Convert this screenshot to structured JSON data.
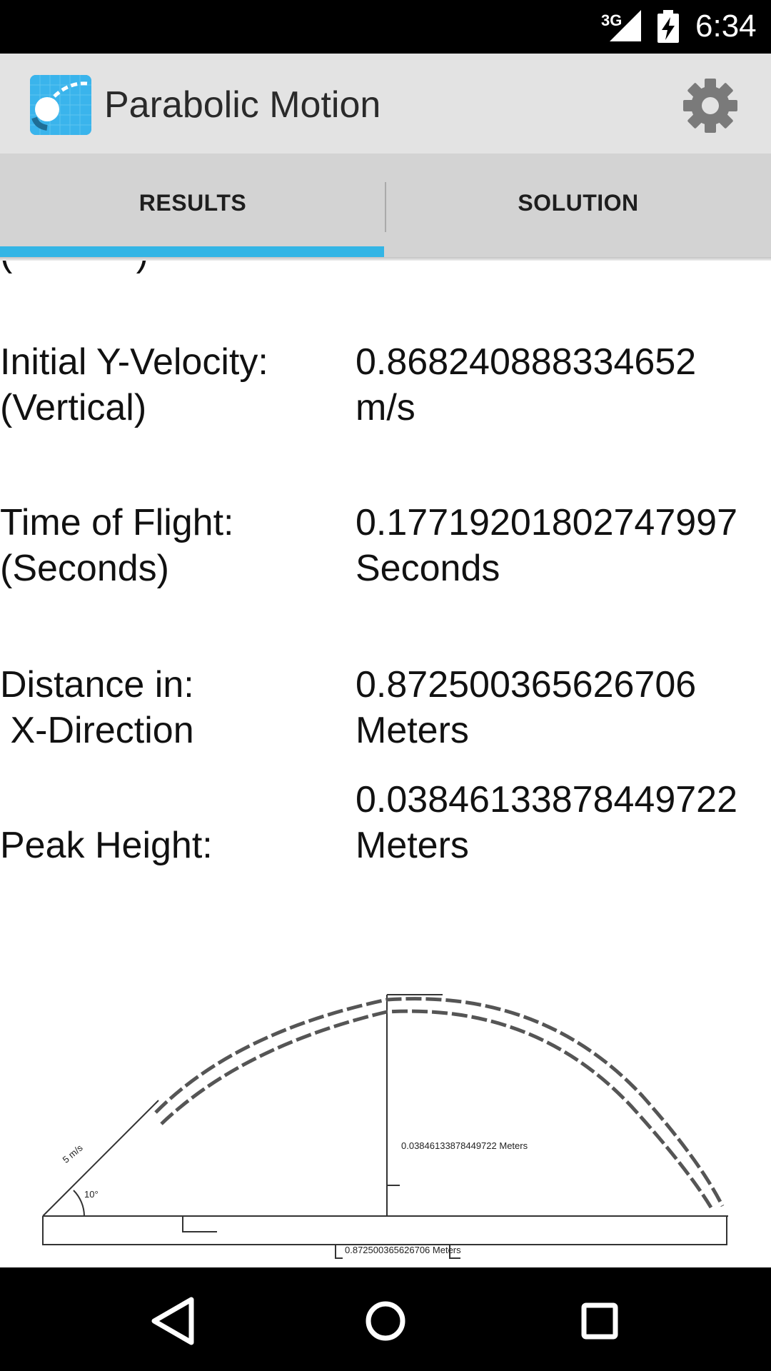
{
  "status_bar": {
    "network": "3G",
    "time": "6:34"
  },
  "app": {
    "title": "Parabolic Motion"
  },
  "tabs": [
    {
      "label": "RESULTS",
      "selected": true
    },
    {
      "label": "SOLUTION",
      "selected": false
    }
  ],
  "results": {
    "partial_top": "(            )",
    "rows": [
      {
        "label": "Initial Y-Velocity:\n(Vertical)",
        "value": "0.868240888334652\nm/s"
      },
      {
        "label": "Time of Flight:\n(Seconds)",
        "value": "0.17719201802747997\nSeconds"
      },
      {
        "label": "Distance in:\n X-Direction",
        "value": "0.872500365626706\nMeters"
      },
      {
        "label": "Peak Height:",
        "value": "0.03846133878449722\nMeters"
      }
    ]
  },
  "diagram": {
    "velocity_label": "5 m/s",
    "angle_label": "10°",
    "peak_label": "0.03846133878449722  Meters",
    "distance_label": "0.872500365626706  Meters"
  },
  "colors": {
    "accent": "#33b5e5",
    "action_bar": "#e3e3e3",
    "tab_bar": "#d3d3d3"
  }
}
